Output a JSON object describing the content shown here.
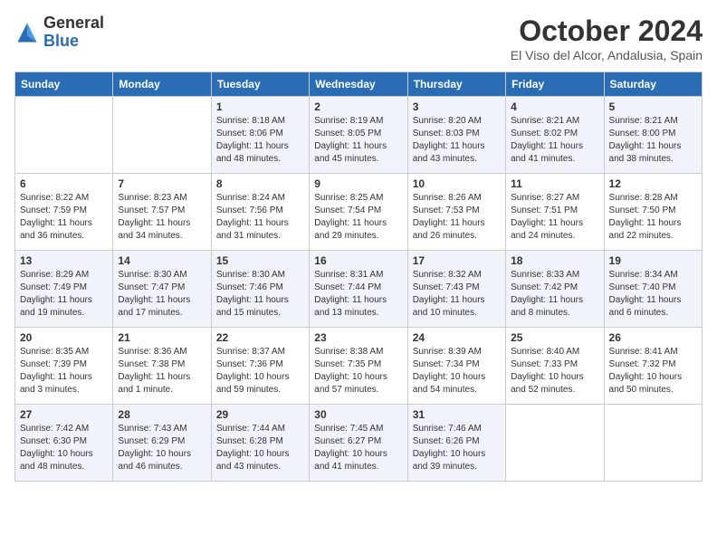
{
  "header": {
    "logo_general": "General",
    "logo_blue": "Blue",
    "month_title": "October 2024",
    "location": "El Viso del Alcor, Andalusia, Spain"
  },
  "days_of_week": [
    "Sunday",
    "Monday",
    "Tuesday",
    "Wednesday",
    "Thursday",
    "Friday",
    "Saturday"
  ],
  "weeks": [
    [
      {
        "day": "",
        "info": ""
      },
      {
        "day": "",
        "info": ""
      },
      {
        "day": "1",
        "info": "Sunrise: 8:18 AM\nSunset: 8:06 PM\nDaylight: 11 hours and 48 minutes."
      },
      {
        "day": "2",
        "info": "Sunrise: 8:19 AM\nSunset: 8:05 PM\nDaylight: 11 hours and 45 minutes."
      },
      {
        "day": "3",
        "info": "Sunrise: 8:20 AM\nSunset: 8:03 PM\nDaylight: 11 hours and 43 minutes."
      },
      {
        "day": "4",
        "info": "Sunrise: 8:21 AM\nSunset: 8:02 PM\nDaylight: 11 hours and 41 minutes."
      },
      {
        "day": "5",
        "info": "Sunrise: 8:21 AM\nSunset: 8:00 PM\nDaylight: 11 hours and 38 minutes."
      }
    ],
    [
      {
        "day": "6",
        "info": "Sunrise: 8:22 AM\nSunset: 7:59 PM\nDaylight: 11 hours and 36 minutes."
      },
      {
        "day": "7",
        "info": "Sunrise: 8:23 AM\nSunset: 7:57 PM\nDaylight: 11 hours and 34 minutes."
      },
      {
        "day": "8",
        "info": "Sunrise: 8:24 AM\nSunset: 7:56 PM\nDaylight: 11 hours and 31 minutes."
      },
      {
        "day": "9",
        "info": "Sunrise: 8:25 AM\nSunset: 7:54 PM\nDaylight: 11 hours and 29 minutes."
      },
      {
        "day": "10",
        "info": "Sunrise: 8:26 AM\nSunset: 7:53 PM\nDaylight: 11 hours and 26 minutes."
      },
      {
        "day": "11",
        "info": "Sunrise: 8:27 AM\nSunset: 7:51 PM\nDaylight: 11 hours and 24 minutes."
      },
      {
        "day": "12",
        "info": "Sunrise: 8:28 AM\nSunset: 7:50 PM\nDaylight: 11 hours and 22 minutes."
      }
    ],
    [
      {
        "day": "13",
        "info": "Sunrise: 8:29 AM\nSunset: 7:49 PM\nDaylight: 11 hours and 19 minutes."
      },
      {
        "day": "14",
        "info": "Sunrise: 8:30 AM\nSunset: 7:47 PM\nDaylight: 11 hours and 17 minutes."
      },
      {
        "day": "15",
        "info": "Sunrise: 8:30 AM\nSunset: 7:46 PM\nDaylight: 11 hours and 15 minutes."
      },
      {
        "day": "16",
        "info": "Sunrise: 8:31 AM\nSunset: 7:44 PM\nDaylight: 11 hours and 13 minutes."
      },
      {
        "day": "17",
        "info": "Sunrise: 8:32 AM\nSunset: 7:43 PM\nDaylight: 11 hours and 10 minutes."
      },
      {
        "day": "18",
        "info": "Sunrise: 8:33 AM\nSunset: 7:42 PM\nDaylight: 11 hours and 8 minutes."
      },
      {
        "day": "19",
        "info": "Sunrise: 8:34 AM\nSunset: 7:40 PM\nDaylight: 11 hours and 6 minutes."
      }
    ],
    [
      {
        "day": "20",
        "info": "Sunrise: 8:35 AM\nSunset: 7:39 PM\nDaylight: 11 hours and 3 minutes."
      },
      {
        "day": "21",
        "info": "Sunrise: 8:36 AM\nSunset: 7:38 PM\nDaylight: 11 hours and 1 minute."
      },
      {
        "day": "22",
        "info": "Sunrise: 8:37 AM\nSunset: 7:36 PM\nDaylight: 10 hours and 59 minutes."
      },
      {
        "day": "23",
        "info": "Sunrise: 8:38 AM\nSunset: 7:35 PM\nDaylight: 10 hours and 57 minutes."
      },
      {
        "day": "24",
        "info": "Sunrise: 8:39 AM\nSunset: 7:34 PM\nDaylight: 10 hours and 54 minutes."
      },
      {
        "day": "25",
        "info": "Sunrise: 8:40 AM\nSunset: 7:33 PM\nDaylight: 10 hours and 52 minutes."
      },
      {
        "day": "26",
        "info": "Sunrise: 8:41 AM\nSunset: 7:32 PM\nDaylight: 10 hours and 50 minutes."
      }
    ],
    [
      {
        "day": "27",
        "info": "Sunrise: 7:42 AM\nSunset: 6:30 PM\nDaylight: 10 hours and 48 minutes."
      },
      {
        "day": "28",
        "info": "Sunrise: 7:43 AM\nSunset: 6:29 PM\nDaylight: 10 hours and 46 minutes."
      },
      {
        "day": "29",
        "info": "Sunrise: 7:44 AM\nSunset: 6:28 PM\nDaylight: 10 hours and 43 minutes."
      },
      {
        "day": "30",
        "info": "Sunrise: 7:45 AM\nSunset: 6:27 PM\nDaylight: 10 hours and 41 minutes."
      },
      {
        "day": "31",
        "info": "Sunrise: 7:46 AM\nSunset: 6:26 PM\nDaylight: 10 hours and 39 minutes."
      },
      {
        "day": "",
        "info": ""
      },
      {
        "day": "",
        "info": ""
      }
    ]
  ]
}
